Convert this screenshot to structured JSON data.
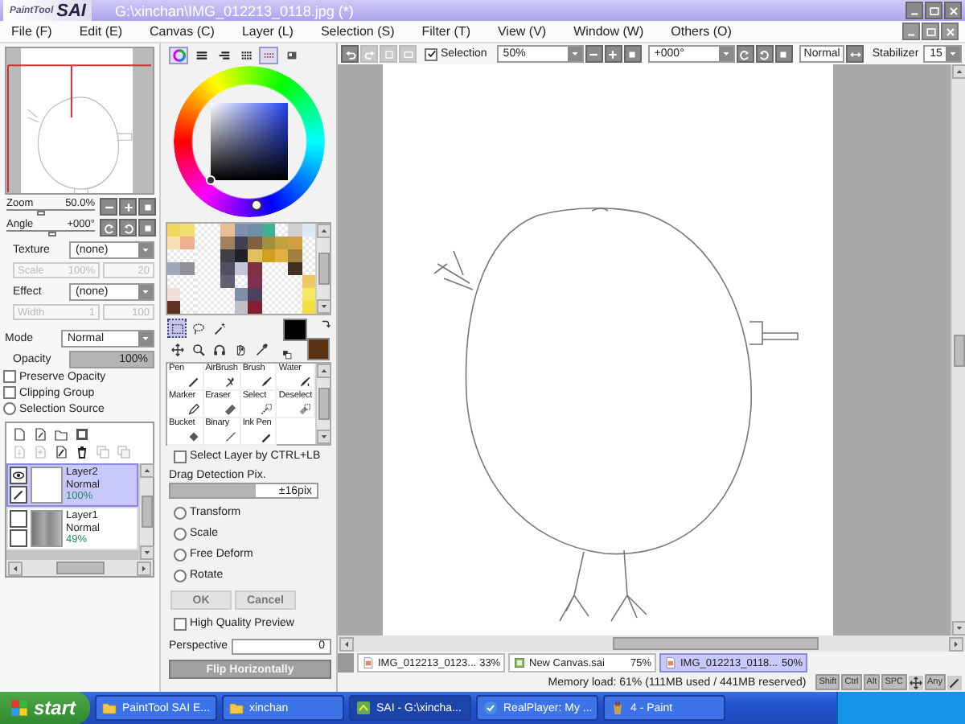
{
  "title_bar": {
    "logo_small": "PaintTool",
    "logo": "SAI",
    "title": "G:\\xinchan\\IMG_012213_0118.jpg (*)"
  },
  "menu": [
    "File (F)",
    "Edit (E)",
    "Canvas (C)",
    "Layer (L)",
    "Selection (S)",
    "Filter (T)",
    "View (V)",
    "Window (W)",
    "Others (O)"
  ],
  "navigator": {
    "zoom": {
      "label": "Zoom",
      "value": "50.0%",
      "level": 0.38
    },
    "angle": {
      "label": "Angle",
      "value": "+000°",
      "level": 0.5
    }
  },
  "brush_texture": {
    "texture": {
      "label": "Texture",
      "value": "(none)"
    },
    "scale": {
      "label": "Scale",
      "value": "100%",
      "extra": "20",
      "disabled": true
    },
    "effect": {
      "label": "Effect",
      "value": "(none)"
    },
    "width": {
      "label": "Width",
      "value": "1",
      "extra": "100",
      "disabled": true
    }
  },
  "layer_settings": {
    "mode": {
      "label": "Mode",
      "value": "Normal"
    },
    "opacity": {
      "label": "Opacity",
      "value": "100%",
      "level": 1
    },
    "options": [
      {
        "kind": "checkbox",
        "label": "Preserve Opacity",
        "checked": false
      },
      {
        "kind": "checkbox",
        "label": "Clipping Group",
        "checked": false
      },
      {
        "kind": "radio",
        "label": "Selection Source",
        "checked": false
      }
    ]
  },
  "layer_buttons": [
    [
      {
        "kind": "new-layer",
        "disabled": false
      },
      {
        "kind": "new-linework",
        "disabled": false
      },
      {
        "kind": "new-set",
        "disabled": false
      },
      {
        "kind": "mask",
        "disabled": false
      }
    ],
    [
      {
        "kind": "transfer",
        "disabled": true
      },
      {
        "kind": "merge",
        "disabled": true
      },
      {
        "kind": "clear",
        "disabled": false
      },
      {
        "kind": "delete",
        "disabled": false
      },
      {
        "kind": "apply",
        "disabled": true
      },
      {
        "kind": "merge-mask",
        "disabled": true
      }
    ]
  ],
  "layers": [
    {
      "name": "Layer2",
      "mode": "Normal",
      "opacity": "100%",
      "visible": true,
      "selected": true,
      "kind": "blank"
    },
    {
      "name": "Layer1",
      "mode": "Normal",
      "opacity": "49%",
      "visible": false,
      "selected": false,
      "kind": "image"
    }
  ],
  "color_tabs": [
    {
      "kind": "wheel",
      "selected": true
    },
    {
      "kind": "rgb",
      "selected": false
    },
    {
      "kind": "hsv",
      "selected": false
    },
    {
      "kind": "mixer",
      "selected": false
    },
    {
      "kind": "swatches",
      "selected": true
    },
    {
      "kind": "scratch",
      "selected": false
    }
  ],
  "swatches": [
    [
      {
        "color": "#f0d860"
      },
      {
        "color": "#f0e070"
      },
      {
        "kind": "empty"
      },
      {
        "kind": "empty"
      },
      {
        "color": "#e8c090"
      },
      {
        "color": "#8090b0"
      },
      {
        "color": "#7090a8"
      },
      {
        "color": "#40b090"
      },
      {
        "kind": "empty"
      },
      {
        "color": "#d0d0d0"
      },
      {
        "color": "#e0e8f0"
      }
    ],
    [
      {
        "color": "#f8e0b0"
      },
      {
        "color": "#f0b090"
      },
      {
        "kind": "empty"
      },
      {
        "kind": "empty"
      },
      {
        "color": "#a08060"
      },
      {
        "color": "#404050"
      },
      {
        "color": "#806040"
      },
      {
        "color": "#a09040"
      },
      {
        "color": "#c0a040"
      },
      {
        "color": "#d0a040"
      },
      {
        "kind": "empty"
      }
    ],
    [
      {
        "kind": "empty"
      },
      {
        "kind": "empty"
      },
      {
        "kind": "empty"
      },
      {
        "kind": "empty"
      },
      {
        "color": "#404048"
      },
      {
        "color": "#202028"
      },
      {
        "color": "#e0c060"
      },
      {
        "color": "#d0a020"
      },
      {
        "color": "#e0b040"
      },
      {
        "color": "#a08040"
      },
      {
        "kind": "empty"
      }
    ],
    [
      {
        "color": "#a0a8b8"
      },
      {
        "color": "#909098"
      },
      {
        "kind": "empty"
      },
      {
        "kind": "empty"
      },
      {
        "color": "#505060"
      },
      {
        "color": "#c0c8d8"
      },
      {
        "color": "#803040"
      },
      {
        "kind": "empty"
      },
      {
        "kind": "empty"
      },
      {
        "color": "#403020"
      },
      {
        "kind": "empty"
      }
    ],
    [
      {
        "kind": "empty"
      },
      {
        "kind": "empty"
      },
      {
        "kind": "empty"
      },
      {
        "kind": "empty"
      },
      {
        "color": "#606070"
      },
      {
        "kind": "empty"
      },
      {
        "color": "#803050"
      },
      {
        "kind": "empty"
      },
      {
        "kind": "empty"
      },
      {
        "kind": "empty"
      },
      {
        "color": "#f0c860"
      }
    ],
    [
      {
        "color": "#f0e0d8"
      },
      {
        "kind": "empty"
      },
      {
        "kind": "empty"
      },
      {
        "kind": "empty"
      },
      {
        "kind": "empty"
      },
      {
        "color": "#8090a8"
      },
      {
        "color": "#504060"
      },
      {
        "kind": "empty"
      },
      {
        "kind": "empty"
      },
      {
        "kind": "empty"
      },
      {
        "color": "#f8e860"
      }
    ],
    [
      {
        "color": "#603020"
      },
      {
        "kind": "empty"
      },
      {
        "kind": "empty"
      },
      {
        "kind": "empty"
      },
      {
        "kind": "empty"
      },
      {
        "color": "#c0c0c8"
      },
      {
        "color": "#802030"
      },
      {
        "kind": "empty"
      },
      {
        "kind": "empty"
      },
      {
        "kind": "empty"
      },
      {
        "color": "#f0e040"
      }
    ]
  ],
  "current_colors": [
    {
      "color": "#000000"
    },
    {
      "color": "#5c3414"
    }
  ],
  "selection_tools": [
    [
      {
        "kind": "marquee",
        "selected": true
      },
      {
        "kind": "lasso",
        "selected": false
      },
      {
        "kind": "wand",
        "selected": false
      }
    ],
    [
      {
        "kind": "move",
        "selected": false
      },
      {
        "kind": "zoom",
        "selected": false
      },
      {
        "kind": "rotate",
        "selected": false
      },
      {
        "kind": "hand",
        "selected": false
      },
      {
        "kind": "eyedropper",
        "selected": false
      }
    ]
  ],
  "tools": [
    {
      "label": "Pen",
      "kind": "pen"
    },
    {
      "label": "AirBrush",
      "kind": "airbrush"
    },
    {
      "label": "Brush",
      "kind": "brush"
    },
    {
      "label": "Water",
      "kind": "water"
    },
    {
      "label": "Marker",
      "kind": "marker"
    },
    {
      "label": "Eraser",
      "kind": "eraser"
    },
    {
      "label": "Select",
      "kind": "select"
    },
    {
      "label": "Deselect",
      "kind": "deselect"
    },
    {
      "label": "Bucket",
      "kind": "bucket"
    },
    {
      "label": "Binary",
      "kind": "binary"
    },
    {
      "label": "Ink Pen",
      "kind": "inkpen"
    }
  ],
  "tool_options": {
    "select_layer": {
      "label": "Select Layer by CTRL+LB",
      "checked": false
    },
    "drag_detection": {
      "label": "Drag Detection Pix.",
      "value": "±16pix",
      "level": 0.58
    },
    "transform_modes": [
      {
        "label": "Transform",
        "selected": false
      },
      {
        "label": "Scale",
        "selected": false
      },
      {
        "label": "Free Deform",
        "selected": false
      },
      {
        "label": "Rotate",
        "selected": false
      }
    ],
    "buttons": [
      {
        "label": "OK",
        "disabled": true
      },
      {
        "label": "Cancel",
        "disabled": true
      }
    ],
    "high_quality_preview": {
      "label": "High Quality Preview",
      "checked": false
    },
    "perspective": {
      "label": "Perspective",
      "value": "0"
    },
    "flip": {
      "label": "Flip Horizontally",
      "disabled": true
    }
  },
  "toolbar": {
    "buttons": [
      {
        "kind": "undo",
        "disabled": false
      },
      {
        "kind": "redo",
        "disabled": true
      },
      {
        "kind": "crop",
        "disabled": true
      },
      {
        "kind": "fit",
        "disabled": true
      }
    ],
    "selection": {
      "label": "Selection",
      "checked": true
    },
    "zoom": "50%",
    "angle": "+000°",
    "blend": "Normal",
    "stabilizer": {
      "label": "Stabilizer",
      "value": "15"
    }
  },
  "doc_tabs": [
    {
      "name": "IMG_012213_0123...",
      "zoom": "33%",
      "kind": "image",
      "selected": false
    },
    {
      "name": "New Canvas.sai",
      "zoom": "75%",
      "kind": "canvas",
      "selected": false
    },
    {
      "name": "IMG_012213_0118...",
      "zoom": "50%",
      "kind": "image",
      "selected": true
    }
  ],
  "status_bar": {
    "memory": "Memory load: 61% (111MB used / 441MB reserved)",
    "keys": [
      {
        "kind": "text",
        "label": "Shift"
      },
      {
        "kind": "text",
        "label": "Ctrl"
      },
      {
        "kind": "text",
        "label": "Alt"
      },
      {
        "kind": "text",
        "label": "SPC"
      },
      {
        "kind": "move"
      },
      {
        "kind": "text",
        "label": "Any"
      },
      {
        "kind": "pen"
      }
    ]
  },
  "taskbar": {
    "start": "start",
    "items": [
      {
        "label": "PaintTool SAI E...",
        "kind": "folder",
        "selected": false
      },
      {
        "label": "xinchan",
        "kind": "folder",
        "selected": false
      },
      {
        "label": "SAI - G:\\xincha...",
        "kind": "sai",
        "selected": true
      },
      {
        "label": "RealPlayer: My ...",
        "kind": "player",
        "selected": false
      },
      {
        "label": "4 - Paint",
        "kind": "paint",
        "selected": false
      }
    ]
  }
}
